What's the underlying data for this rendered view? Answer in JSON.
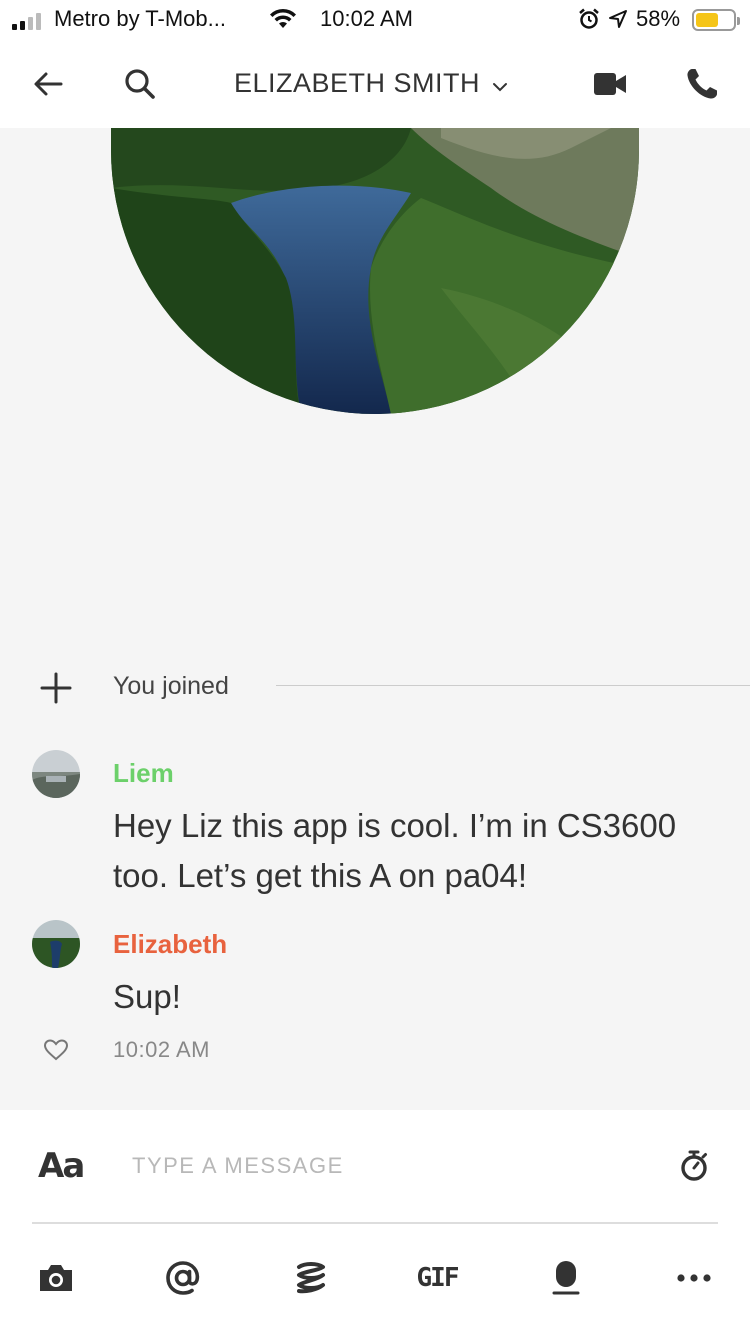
{
  "status_bar": {
    "carrier": "Metro by T-Mob...",
    "time": "10:02 AM",
    "battery_percent": "58%",
    "battery_level": 0.58,
    "battery_color": "#f5c518"
  },
  "header": {
    "title": "ELIZABETH SMITH",
    "icons": [
      "back-arrow-icon",
      "search-icon",
      "chevron-down-icon",
      "video-camera-icon",
      "phone-icon"
    ]
  },
  "conversation": {
    "joined_text": "You joined",
    "messages": [
      {
        "sender": "Liem",
        "sender_color": "#6cd06a",
        "text_line1": "Hey Liz this app is cool. I’m in CS3600",
        "text_line2": "too. Let’s get this A on pa04!"
      },
      {
        "sender": "Elizabeth",
        "sender_color": "#e8623e",
        "text": "Sup!",
        "time": "10:02 AM"
      }
    ]
  },
  "composer": {
    "format_label": "Aa",
    "placeholder": "TYPE A MESSAGE",
    "gif_label": "GIF",
    "tools": [
      "camera-icon",
      "mention-icon",
      "sticker-icon",
      "gif-button",
      "microphone-icon",
      "more-icon"
    ]
  }
}
